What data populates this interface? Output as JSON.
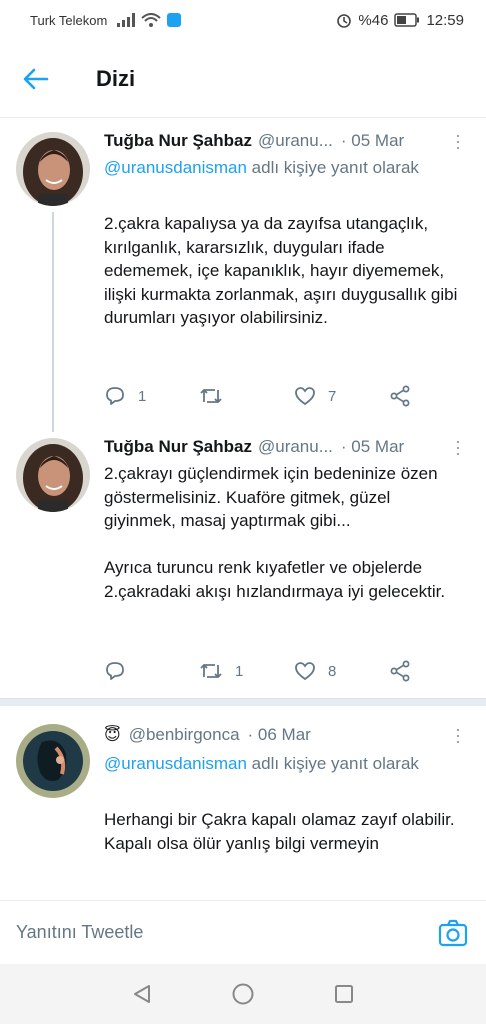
{
  "status": {
    "carrier": "Turk Telekom",
    "battery": "%46",
    "time": "12:59"
  },
  "header": {
    "title": "Dizi",
    "back_icon": "arrow-left-icon"
  },
  "tweets": [
    {
      "name": "Tuğba Nur Şahbaz",
      "handle": "@uranu...",
      "date": "· 05 Mar",
      "reply_to_user": "@uranusdanisman",
      "reply_to_suffix": " adlı kişiye yanıt olarak",
      "text": "2.çakra kapalıysa ya da zayıfsa utangaçlık, kırılganlık, kararsızlık, duyguları ifade edememek, içe kapanıklık, hayır diyememek, ilişki kurmakta zorlanmak, aşırı duygusallık gibi durumları yaşıyor olabilirsiniz.",
      "replies": "1",
      "retweets": "",
      "likes": "7"
    },
    {
      "name": "Tuğba Nur Şahbaz",
      "handle": "@uranu...",
      "date": "· 05 Mar",
      "text": "2.çakrayı güçlendirmek için bedeninize özen göstermelisiniz. Kuaföre gitmek, güzel giyinmek, masaj yaptırmak gibi...\n\nAyrıca turuncu renk kıyafetler ve objelerde 2.çakradaki akışı hızlandırmaya iyi gelecektir.",
      "replies": "",
      "retweets": "1",
      "likes": "8"
    },
    {
      "name_emoji": "😇",
      "handle": "@benbirgonca",
      "date": "· 06 Mar",
      "reply_to_user": "@uranusdanisman",
      "reply_to_suffix": " adlı kişiye yanıt olarak",
      "text": "Herhangi bir Çakra kapalı olamaz zayıf olabilir. Kapalı olsa ölür yanlış bilgi vermeyin"
    }
  ],
  "composer": {
    "placeholder": "Yanıtını Tweetle"
  },
  "colors": {
    "accent": "#1da1f2",
    "text": "#14171a",
    "muted": "#657786"
  }
}
